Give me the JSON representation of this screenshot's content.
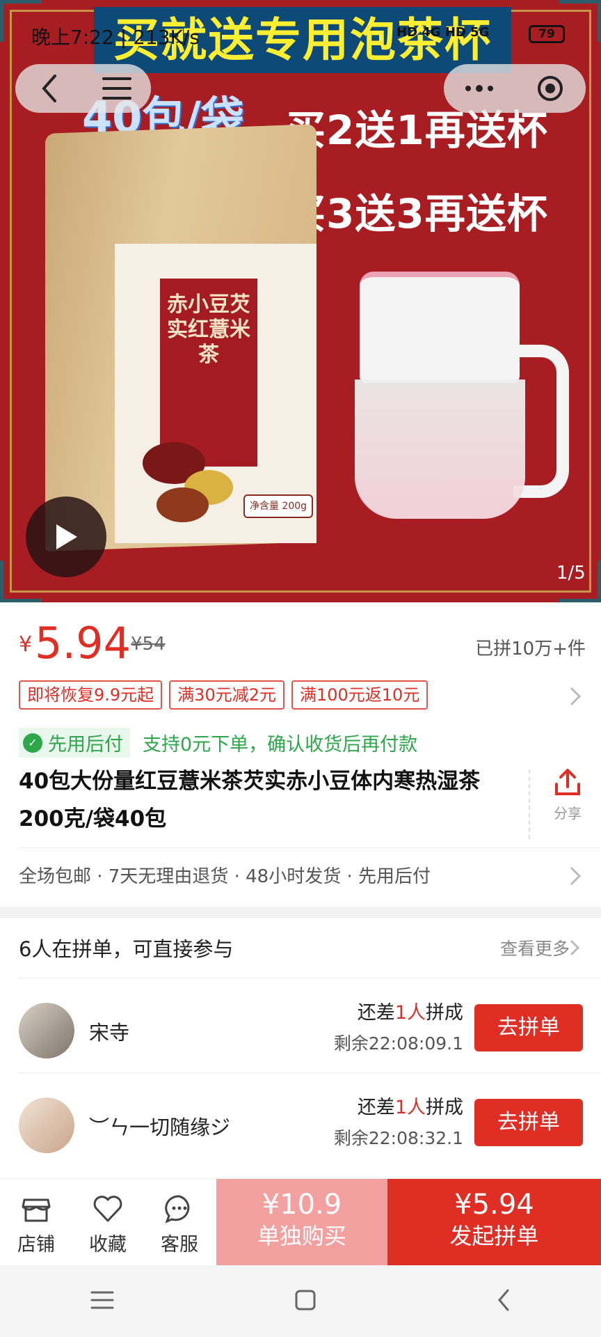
{
  "status": {
    "time": "晚上7:22 | 213K/s",
    "signal": "HD 4G  HD 5G",
    "battery": "79"
  },
  "hero": {
    "banner": "买就送专用泡茶杯",
    "badge": "40包/袋",
    "promo1": "买2送1再送杯",
    "promo2": "买3送3再送杯",
    "bag_text": "赤小豆芡实红薏米茶",
    "bag_tag": "净含量 200g",
    "pager": "1/5"
  },
  "price": {
    "yen": "¥",
    "current": "5.94",
    "original": "¥54",
    "sold": "已拼10万+件"
  },
  "coupons": [
    "即将恢复9.9元起",
    "满30元减2元",
    "满100元返10元"
  ],
  "paylater": {
    "badge": "先用后付",
    "desc": "支持0元下单，确认收货后再付款"
  },
  "product": {
    "title": "40包大份量红豆薏米茶芡实赤小豆体内寒热湿茶200克/袋40包",
    "share": "分享"
  },
  "services": "全场包邮 · 7天无理由退货 · 48小时发货 · 先用后付",
  "groups": {
    "header": "6人在拼单，可直接参与",
    "see_more": "查看更多",
    "items": [
      {
        "name": "宋寺",
        "need_pre": "还差",
        "need_num": "1人",
        "need_post": "拼成",
        "remaining": "剩余22:08:09.1",
        "button": "去拼单"
      },
      {
        "name": "︶ㄣ一切随缘ジ",
        "need_pre": "还差",
        "need_num": "1人",
        "need_post": "拼成",
        "remaining": "剩余22:08:32.1",
        "button": "去拼单"
      }
    ]
  },
  "bottom": {
    "shop": "店铺",
    "fav": "收藏",
    "service": "客服",
    "solo_price": "¥10.9",
    "solo_label": "单独购买",
    "group_price": "¥5.94",
    "group_label": "发起拼单"
  }
}
